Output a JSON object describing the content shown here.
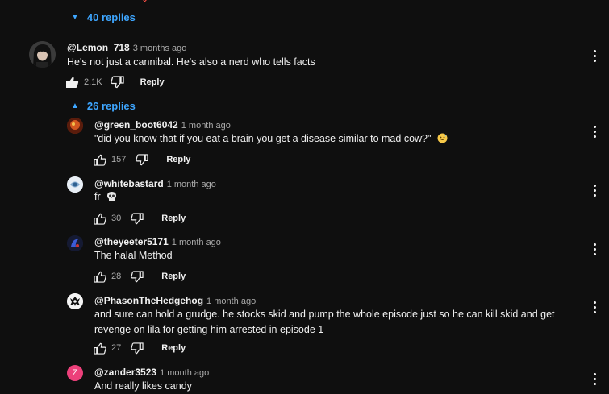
{
  "top_thread": {
    "replies_label": "40 replies"
  },
  "main_comment": {
    "author": "@Lemon_718",
    "time": "3 months ago",
    "text": "He's not just a cannibal. He's also a nerd who tells facts",
    "likes": "2.1K",
    "reply_label": "Reply",
    "replies_label": "26 replies"
  },
  "replies": [
    {
      "author": "@green_boot6042",
      "time": "1 month ago",
      "text": "\"did you know that if you eat a brain you get a disease similar to mad cow?\"",
      "likes": "157",
      "reply_label": "Reply",
      "emoji": "grinning-sweat-face-icon"
    },
    {
      "author": "@whitebastard",
      "time": "1 month ago",
      "text": "fr",
      "likes": "30",
      "reply_label": "Reply",
      "emoji": "skull-icon"
    },
    {
      "author": "@theyeeter5171",
      "time": "1 month ago",
      "text": "The halal Method",
      "likes": "28",
      "reply_label": "Reply"
    },
    {
      "author": "@PhasonTheHedgehog",
      "time": "1 month ago",
      "text": "and sure can hold a grudge. he stocks skid and pump the whole episode just so he can kill skid and get revenge on lila for getting him arrested in episode 1",
      "likes": "27",
      "reply_label": "Reply"
    },
    {
      "author": "@zander3523",
      "time": "1 month ago",
      "text": "And really likes candy",
      "avatar_letter": "Z"
    }
  ],
  "colors": {
    "background": "#0f0f0f",
    "link_blue": "#3ea6ff",
    "zander_avatar": "#ec407a"
  }
}
